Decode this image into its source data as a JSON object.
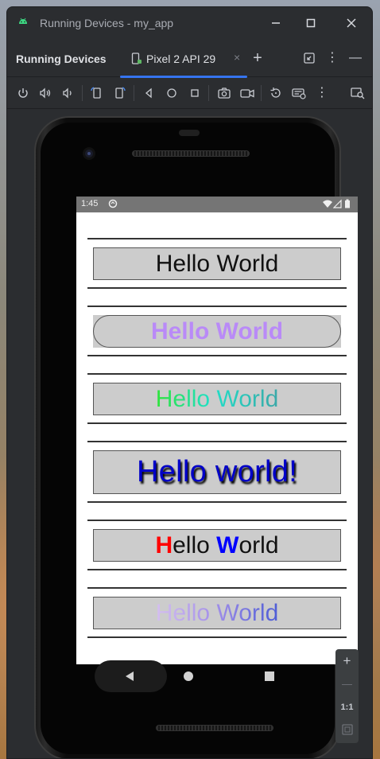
{
  "window": {
    "title": "Running Devices - my_app"
  },
  "tool_window": {
    "title": "Running Devices",
    "device_tab_label": "Pixel 2 API 29",
    "tab_close_symbol": "×",
    "add_symbol": "+",
    "more_symbol": "⋮",
    "minimize_symbol": "—"
  },
  "toolbar": {
    "icons": [
      "power-icon",
      "volume-up-icon",
      "volume-down-icon",
      "rotate-left-icon",
      "rotate-right-icon",
      "back-icon",
      "home-icon",
      "overview-icon",
      "screenshot-icon",
      "screen-record-icon",
      "reset-icon",
      "device-settings-icon",
      "more-icon",
      "device-inspector-icon"
    ]
  },
  "device": {
    "status_time": "1:45",
    "screen": {
      "items": [
        {
          "text": "Hello World",
          "style": "plain"
        },
        {
          "text": "Hello World",
          "style": "purple-pill",
          "color": "#b98af7"
        },
        {
          "text": "Hello World",
          "style": "green-gradient"
        },
        {
          "text": "Hello world!",
          "style": "blue-shadow",
          "color": "#0000c8"
        },
        {
          "text_parts": [
            "H",
            "ello ",
            "W",
            "orld"
          ],
          "style": "mixed-colors",
          "colors": [
            "#ff0000",
            "#111111",
            "#0000ff",
            "#111111"
          ]
        },
        {
          "text": "Hello World",
          "style": "faded-gradient"
        }
      ]
    }
  },
  "zoom_panel": {
    "zoom_in": "+",
    "zoom_out": "—",
    "actual_size": "1:1"
  }
}
